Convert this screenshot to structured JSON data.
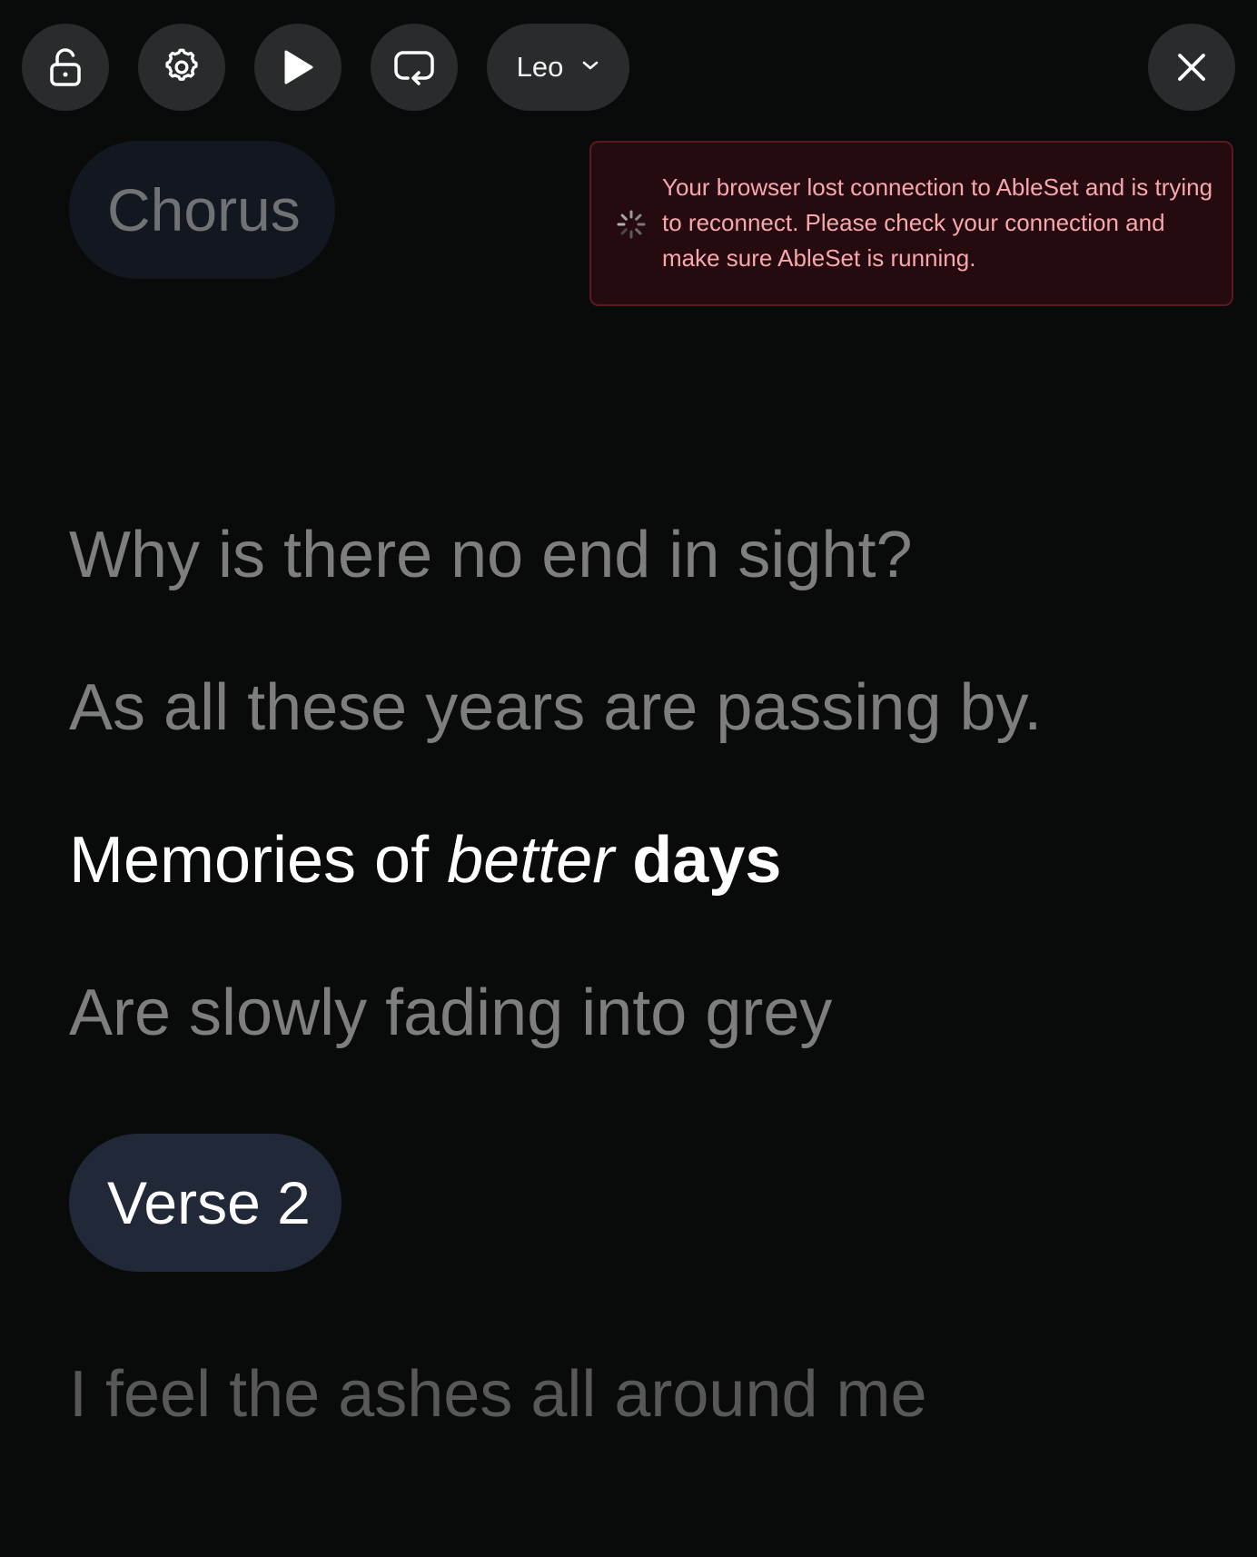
{
  "toolbar": {
    "lock_icon": "unlock-icon",
    "settings_icon": "gear-icon",
    "play_icon": "play-icon",
    "loop_icon": "loop-icon",
    "speaker": "Leo",
    "speaker_icon": "chevron-down-icon",
    "close_icon": "close-icon"
  },
  "toast": {
    "icon": "spinner-icon",
    "message": "Your browser lost connection to AbleSet and is trying to reconnect. Please check your connection and make sure AbleSet is running."
  },
  "colors": {
    "background": "#090b0b",
    "button_bg": "#2a2b2d",
    "toast_bg": "#250b0f",
    "toast_border": "#5a1a21",
    "toast_text": "#f8a7ae",
    "active_section_bg": "#212938",
    "inactive_section_bg": "#131820",
    "lyric_dim": "#7e7e7e",
    "lyric_active": "#ffffff"
  },
  "sections": [
    {
      "name": "Chorus",
      "state": "past",
      "lines": [
        "Why is there no end in sight?",
        "As all these years are passing by."
      ]
    }
  ],
  "current_line": {
    "part1": "Memories of ",
    "italic": "better",
    "space": " ",
    "bold": "days"
  },
  "upcoming_lines": [
    "Are slowly fading into grey"
  ],
  "next_section": {
    "name": "Verse 2",
    "state": "upcoming",
    "lines": [
      "I feel the ashes all around me"
    ]
  }
}
